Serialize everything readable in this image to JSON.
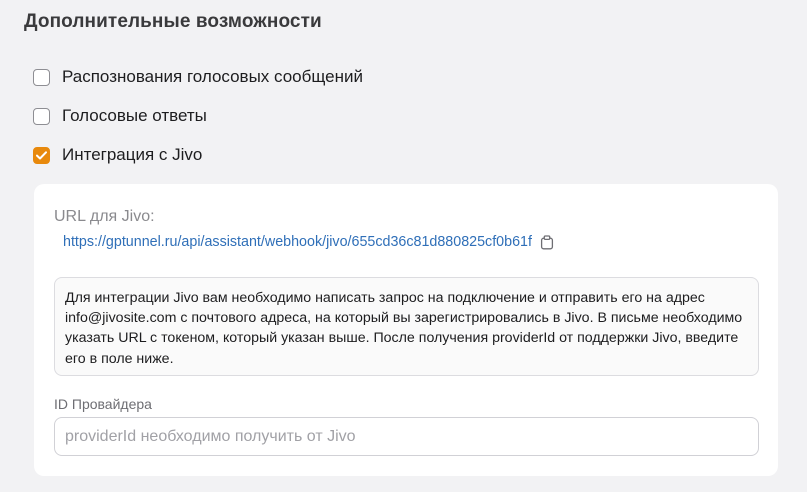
{
  "section": {
    "title": "Дополнительные возможности"
  },
  "options": [
    {
      "label": "Распознования голосовых сообщений",
      "checked": false
    },
    {
      "label": "Голосовые ответы",
      "checked": false
    },
    {
      "label": "Интеграция с Jivo",
      "checked": true
    }
  ],
  "jivo": {
    "url_label": "URL для Jivo:",
    "url": "https://gptunnel.ru/api/assistant/webhook/jivo/655cd36c81d880825cf0b61f",
    "copy_icon": "copy-icon",
    "info_text": "Для интеграции Jivo вам необходимо написать запрос на подключение и отправить его на адрес info@jivosite.com с почтового адреса, на который вы зарегистрировались в Jivo. В письме необходимо указать URL с токеном, который указан выше. После получения providerId от поддержки Jivo, введите его в поле ниже.",
    "provider_label": "ID Провайдера",
    "provider_value": "",
    "provider_placeholder": "providerId необходимо получить от Jivo"
  },
  "colors": {
    "accent": "#e8890c",
    "link": "#2f6fb8",
    "background": "#f2f2f4",
    "panel": "#ffffff"
  }
}
